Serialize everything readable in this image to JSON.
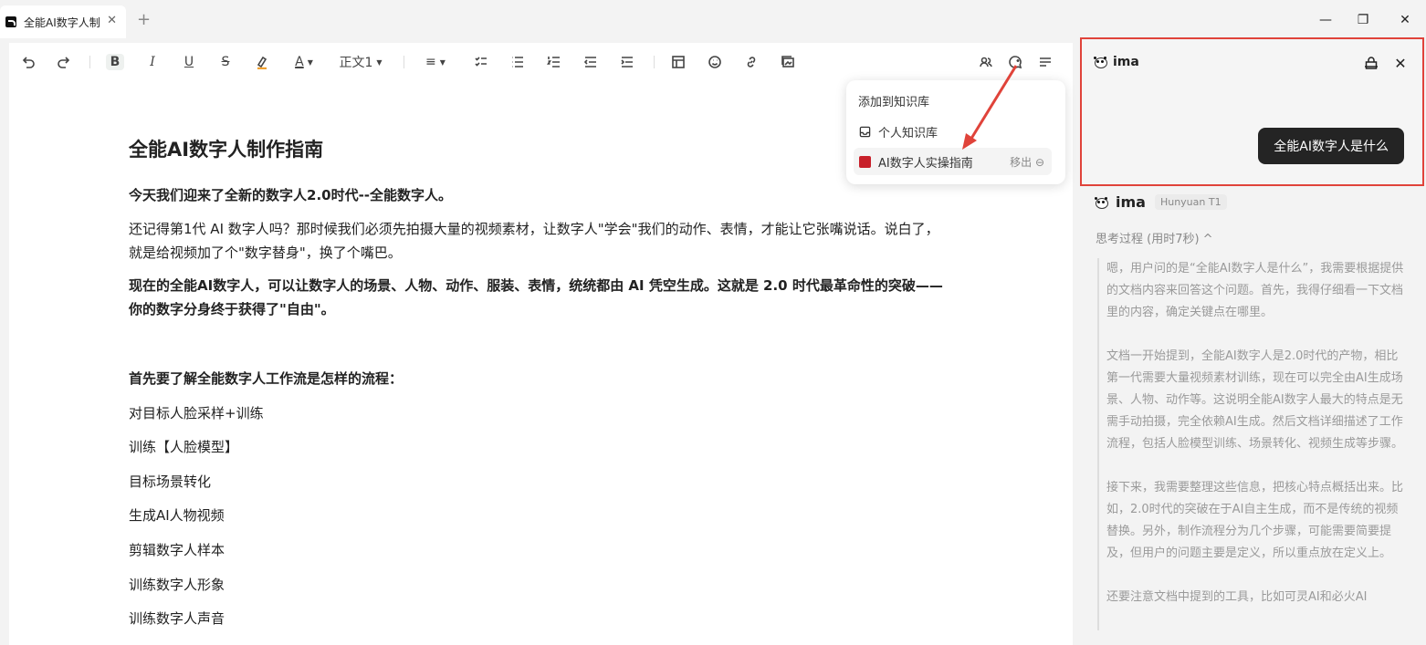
{
  "tabs": [
    {
      "title": "全能AI数字人制作指南"
    }
  ],
  "window": {
    "minimize": "—",
    "maximize": "❐",
    "close": "✕"
  },
  "toolbar": {
    "style_select": "正文1"
  },
  "document": {
    "title": "全能AI数字人制作指南",
    "paragraphs": [
      {
        "text": "今天我们迎来了全新的数字人2.0时代--全能数字人。",
        "bold": true
      },
      {
        "text": "还记得第1代 AI 数字人吗？那时候我们必须先拍摄大量的视频素材，让数字人\"学会\"我们的动作、表情，才能让它张嘴说话。说白了，就是给视频加了个\"数字替身\"，换了个嘴巴。",
        "bold": false
      },
      {
        "text": "现在的全能AI数字人，可以让数字人的场景、人物、动作、服装、表情，统统都由 AI 凭空生成。这就是 2.0 时代最革命性的突破——你的数字分身终于获得了\"自由\"。",
        "bold": true
      },
      {
        "text": "首先要了解全能数字人工作流是怎样的流程：",
        "bold": true
      },
      {
        "text": "对目标人脸采样+训练",
        "bold": false
      },
      {
        "text": "训练【人脸模型】",
        "bold": false
      },
      {
        "text": "目标场景转化",
        "bold": false
      },
      {
        "text": "生成AI人物视频",
        "bold": false
      },
      {
        "text": "剪辑数字人样本",
        "bold": false
      },
      {
        "text": "训练数字人形象",
        "bold": false
      },
      {
        "text": "训练数字人声音",
        "bold": false
      }
    ]
  },
  "kb_popup": {
    "title": "添加到知识库",
    "items": [
      {
        "label": "个人知识库",
        "action": ""
      },
      {
        "label": "AI数字人实操指南",
        "action": "移出"
      }
    ]
  },
  "ima_panel": {
    "name": "ima",
    "user_query": "全能AI数字人是什么",
    "reply_name": "ima",
    "model": "Hunyuan T1",
    "thinking_label": "思考过程 (用时7秒) ^",
    "thinking": [
      "嗯，用户问的是“全能AI数字人是什么”，我需要根据提供的文档内容来回答这个问题。首先，我得仔细看一下文档里的内容，确定关键点在哪里。",
      "文档一开始提到，全能AI数字人是2.0时代的产物，相比第一代需要大量视频素材训练，现在可以完全由AI生成场景、人物、动作等。这说明全能AI数字人最大的特点是无需手动拍摄，完全依赖AI生成。然后文档详细描述了工作流程，包括人脸模型训练、场景转化、视频生成等步骤。",
      "接下来，我需要整理这些信息，把核心特点概括出来。比如，2.0时代的突破在于AI自主生成，而不是传统的视频替换。另外，制作流程分为几个步骤，可能需要简要提及，但用户的问题主要是定义，所以重点放在定义上。",
      "还要注意文档中提到的工具，比如可灵AI和必火AI"
    ]
  },
  "colors": {
    "accent_red": "#e0433a",
    "dark_button": "#242424"
  }
}
